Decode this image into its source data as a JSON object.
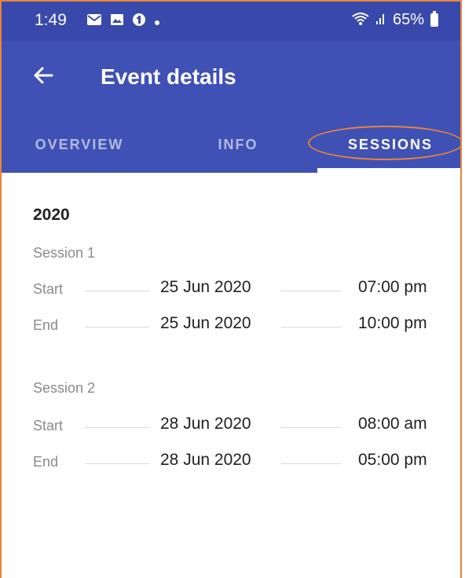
{
  "status_bar": {
    "time": "1:49",
    "icons": [
      "message-icon",
      "image-icon",
      "app-icon",
      "dot-icon"
    ],
    "battery": "65%"
  },
  "toolbar": {
    "title": "Event details"
  },
  "tabs": [
    {
      "label": "OVERVIEW",
      "active": false
    },
    {
      "label": "INFO",
      "active": false
    },
    {
      "label": "SESSIONS",
      "active": true
    }
  ],
  "content": {
    "year": "2020",
    "sessions": [
      {
        "title": "Session 1",
        "start": {
          "label": "Start",
          "date": "25 Jun 2020",
          "time": "07:00 pm"
        },
        "end": {
          "label": "End",
          "date": "25 Jun 2020",
          "time": "10:00 pm"
        }
      },
      {
        "title": "Session 2",
        "start": {
          "label": "Start",
          "date": "28 Jun 2020",
          "time": "08:00 am"
        },
        "end": {
          "label": "End",
          "date": "28 Jun 2020",
          "time": "05:00 pm"
        }
      }
    ]
  },
  "colors": {
    "primary": "#3F51B5",
    "status_bar": "#3949AB",
    "annotation": "#E8833A"
  }
}
